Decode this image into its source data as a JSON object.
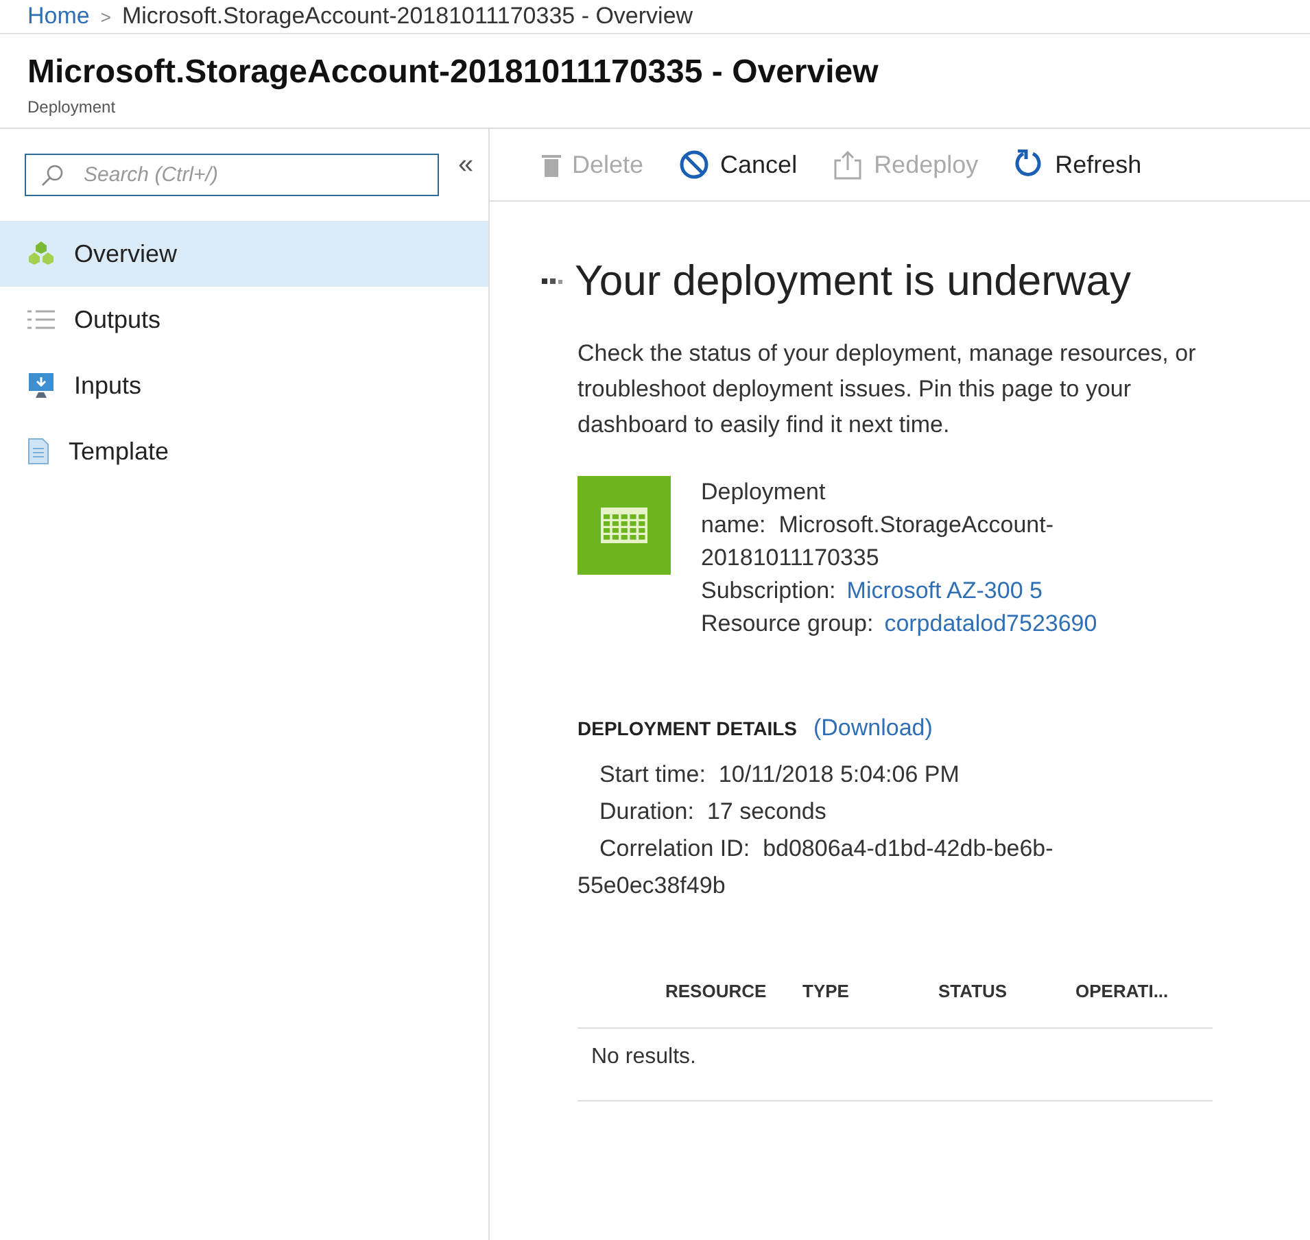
{
  "breadcrumb": [
    {
      "label": "Home",
      "link": true
    },
    {
      "label": "Microsoft.StorageAccount-20181011170335 - Overview",
      "link": false
    }
  ],
  "breadcrumb_separator": ">",
  "title": "Microsoft.StorageAccount-20181011170335 - Overview",
  "subtitle": "Deployment",
  "search": {
    "placeholder": "Search (Ctrl+/)"
  },
  "collapse": "«",
  "sidebar": {
    "items": [
      {
        "label": "Overview",
        "kind": "overview",
        "selected": true
      },
      {
        "label": "Outputs",
        "kind": "outputs",
        "selected": false
      },
      {
        "label": "Inputs",
        "kind": "inputs",
        "selected": false
      },
      {
        "label": "Template",
        "kind": "template",
        "selected": false
      }
    ]
  },
  "toolbar": [
    {
      "label": "Delete",
      "kind": "delete",
      "disabled": true
    },
    {
      "label": "Cancel",
      "kind": "cancel",
      "disabled": false
    },
    {
      "label": "Redeploy",
      "kind": "redeploy",
      "disabled": true
    },
    {
      "label": "Refresh",
      "kind": "refresh",
      "disabled": false
    }
  ],
  "heading": "Your deployment is underway",
  "description": "Check the status of your deployment, manage resources, or troubleshoot deployment issues. Pin this page to your dashboard to easily find it next time.",
  "deployment": [
    {
      "label": "Deployment name:",
      "value": "Microsoft.StorageAccount-20181011170335",
      "link": false
    },
    {
      "label": "Subscription:",
      "value": "Microsoft AZ-300 5",
      "link": true
    },
    {
      "label": "Resource group:",
      "value": "corpdatalod7523690",
      "link": true
    }
  ],
  "details": {
    "title": "DEPLOYMENT DETAILS",
    "action": "(Download)",
    "rows": [
      {
        "label": "Start time:",
        "value": "10/11/2018 5:04:06 PM"
      },
      {
        "label": "Duration:",
        "value": "17 seconds"
      },
      {
        "label": "Correlation ID:",
        "value": "bd0806a4-d1bd-42db-be6b-55e0ec38f49b"
      }
    ]
  },
  "table": {
    "columns": [
      "RESOURCE",
      "TYPE",
      "STATUS",
      "OPERATI..."
    ],
    "empty": "No results."
  }
}
